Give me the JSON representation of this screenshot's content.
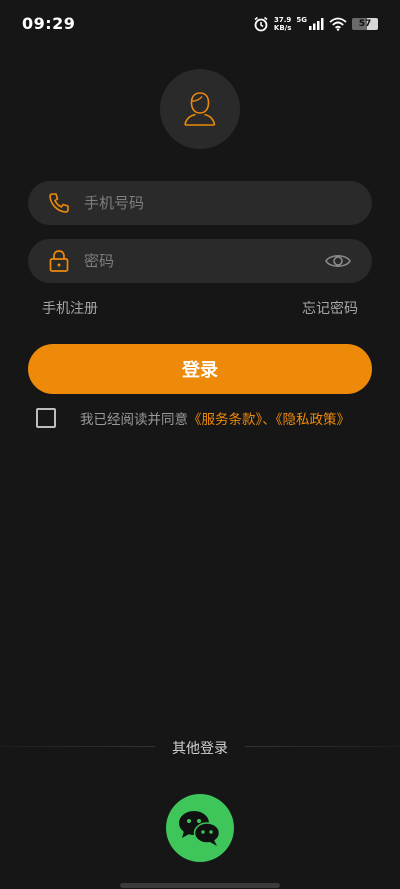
{
  "status": {
    "time": "09:29",
    "net_speed_value": "37.9",
    "net_speed_unit": "KB/s",
    "network": "5G",
    "battery": "57",
    "battery_level": 0.57
  },
  "form": {
    "phone_placeholder": "手机号码",
    "password_placeholder": "密码",
    "register_link": "手机注册",
    "forgot_link": "忘记密码",
    "login_button": "登录"
  },
  "agreement": {
    "prefix": "我已经阅读并同意",
    "terms": "《服务条款》",
    "separator": "、",
    "privacy": "《隐私政策》"
  },
  "other": {
    "label": "其他登录"
  },
  "colors": {
    "accent": "#ee8a0a",
    "wechat": "#3ec65a",
    "background": "#161616",
    "field": "#2a2a2a"
  },
  "icons": [
    "alarm-icon",
    "signal-icon",
    "wifi-icon",
    "battery-icon",
    "user-icon",
    "phone-icon",
    "lock-icon",
    "eye-icon",
    "wechat-icon"
  ]
}
